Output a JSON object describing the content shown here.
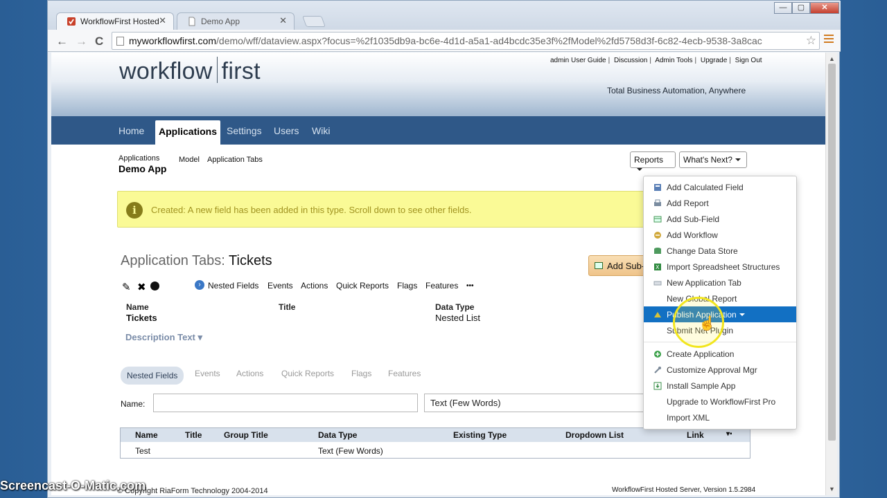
{
  "browser": {
    "tabs": [
      {
        "label": "WorkflowFirst Hosted"
      },
      {
        "label": "Demo App"
      }
    ],
    "controls": {
      "minimize": "—",
      "maximize": "▢",
      "close": "✕"
    },
    "nav": {
      "back": "←",
      "forward": "→",
      "reload": "C"
    },
    "url_domain": "myworkflowfirst.com",
    "url_rest": "/demo/wff/dataview.aspx?focus=%2f1035db9a-bc6e-4d1d-a5a1-ad4bcdc35e3f%2fModel%2fd5758d3f-6c82-4ecb-9538-3a8cac",
    "star": "☆"
  },
  "header": {
    "logo_left": "workflow",
    "logo_right": "first",
    "top_links": [
      "admin",
      "User Guide",
      "Discussion",
      "Admin Tools",
      "Upgrade",
      "Sign Out"
    ],
    "tagline": "Total Business Automation, Anywhere"
  },
  "mainnav": [
    "Home",
    "Applications",
    "Settings",
    "Users",
    "Wiki"
  ],
  "breadcrumb": {
    "top": "Applications",
    "app": "Demo App",
    "links": [
      "Model",
      "Application Tabs"
    ]
  },
  "buttons": {
    "reports": "Reports",
    "whats_next": "What's Next?",
    "add_sub": "Add Sub-Field"
  },
  "alert": {
    "icon": "i",
    "message": "Created: A new field has been added in this type. Scroll down to see other fields."
  },
  "section": {
    "prefix": "Application Tabs:",
    "name": "Tickets"
  },
  "tools": {
    "edit": "✎",
    "delete": "✖",
    "more": "•••",
    "go": "›"
  },
  "subnav": [
    "Nested Fields",
    "Events",
    "Actions",
    "Quick Reports",
    "Flags",
    "Features"
  ],
  "fields": {
    "name_label": "Name",
    "name_value": "Tickets",
    "title_label": "Title",
    "type_label": "Data Type",
    "type_value": "Nested List",
    "description": "Description Text ▾"
  },
  "pill_tabs": [
    "Nested Fields",
    "Events",
    "Actions",
    "Quick Reports",
    "Flags",
    "Features"
  ],
  "form": {
    "name_label": "Name:",
    "name_value": "",
    "type_value": "Text (Few Words)"
  },
  "table": {
    "columns": [
      "Name",
      "Title",
      "Group Title",
      "Data Type",
      "Existing Type",
      "Dropdown List",
      "Link",
      "▾▪"
    ],
    "rows": [
      {
        "name": "Test",
        "title": "",
        "group_title": "",
        "data_type": "Text (Few Words)"
      }
    ]
  },
  "dropdown": {
    "items": [
      {
        "label": "Add Calculated Field",
        "icon": "calculator-icon",
        "color": "#5a7fb6"
      },
      {
        "label": "Add Report",
        "icon": "printer-icon",
        "color": "#7a8ca0"
      },
      {
        "label": "Add Sub-Field",
        "icon": "table-icon",
        "color": "#4a9a5a"
      },
      {
        "label": "Add Workflow",
        "icon": "workflow-icon",
        "color": "#d1a93c"
      },
      {
        "label": "Change Data Store",
        "icon": "datastore-icon",
        "color": "#4e9a5e"
      },
      {
        "label": "Import Spreadsheet Structures",
        "icon": "spreadsheet-icon",
        "color": "#2f8a3f"
      },
      {
        "label": "New Application Tab",
        "icon": "tab-icon",
        "color": "#9aa4ae"
      },
      {
        "label": "New Global Report",
        "icon": "",
        "color": ""
      },
      {
        "label": "Publish Application",
        "icon": "publish-icon",
        "color": "#d8c23a"
      },
      {
        "label": "Submit Net Plugin",
        "icon": "",
        "color": ""
      },
      {
        "label": "Create Application",
        "icon": "plus-circle-icon",
        "color": "#3aa048"
      },
      {
        "label": "Customize Approval Mgr",
        "icon": "wrench-icon",
        "color": "#7c8a99"
      },
      {
        "label": "Install Sample App",
        "icon": "install-icon",
        "color": "#3a8f4a"
      },
      {
        "label": "Upgrade to WorkflowFirst Pro",
        "icon": "",
        "color": ""
      },
      {
        "label": "Import XML",
        "icon": "",
        "color": ""
      }
    ],
    "highlight_color": "#1270c3"
  },
  "footer": {
    "copyright": "© Copyright RiaForm Technology 2004-2014",
    "version": "WorkflowFirst Hosted Server, Version 1.5.2984"
  },
  "watermark": "Screencast-O-Matic.com"
}
